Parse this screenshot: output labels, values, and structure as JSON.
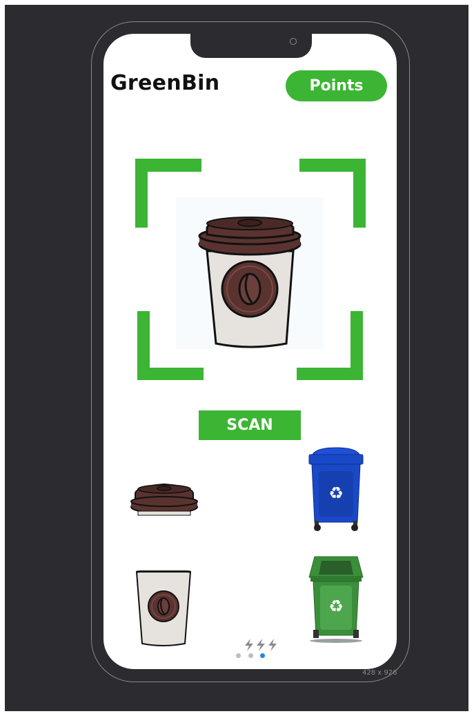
{
  "app": {
    "title": "GreenBin",
    "points_label": "Points",
    "scan_label": "SCAN"
  },
  "scanner": {
    "subject_icon": "coffee-cup-icon"
  },
  "scene": {
    "items": [
      "coffee-lid-icon",
      "coffee-cup-body-icon"
    ],
    "bins": [
      "blue-recycling-bin-icon",
      "green-recycling-bin-icon"
    ]
  },
  "pager": {
    "pages": 3,
    "active_page": 3,
    "icon": "lightning-icon"
  },
  "canvas": {
    "size_label": "428 x 926"
  },
  "colors": {
    "accent_green": "#3cb534",
    "background": "#2c2b30",
    "active_dot": "#1e88e5",
    "inactive_dot": "#bdbdbd",
    "bin_blue": "#1a49c8",
    "bin_green": "#3b8f3b"
  }
}
